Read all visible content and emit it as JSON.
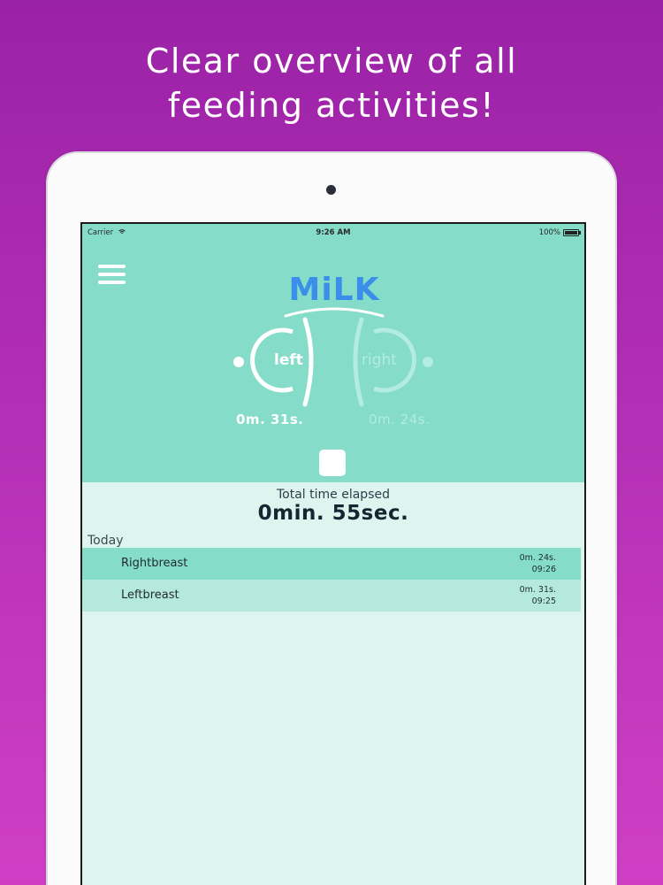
{
  "promo": {
    "line1": "Clear overview of all",
    "line2": "feeding activities!"
  },
  "status_bar": {
    "carrier": "Carrier",
    "time": "9:26 AM",
    "battery": "100%"
  },
  "header": {
    "logo": "MiLK"
  },
  "feeding": {
    "left": {
      "label": "left",
      "time": "0m. 31s."
    },
    "right": {
      "label": "right",
      "time": "0m. 24s."
    }
  },
  "summary": {
    "label": "Total time elapsed",
    "value": "0min. 55sec."
  },
  "history": {
    "section_label": "Today",
    "entries": [
      {
        "name": "Rightbreast",
        "duration": "0m. 24s.",
        "time": "09:26"
      },
      {
        "name": "Leftbreast",
        "duration": "0m. 31s.",
        "time": "09:25"
      }
    ]
  },
  "colors": {
    "background_top": "#9a22a6",
    "background_bottom": "#cf3fc6",
    "header": "#84dcc9",
    "content": "#ddf4ef",
    "logo": "#3b8ee9",
    "row_dark": "#84dcc9",
    "row_light": "#b5e9dd"
  }
}
